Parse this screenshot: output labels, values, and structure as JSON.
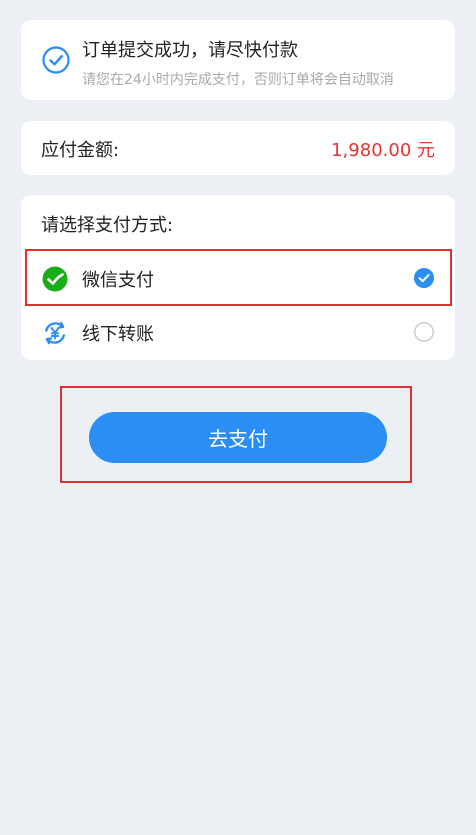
{
  "status": {
    "title": "订单提交成功，请尽快付款",
    "subtitle": "请您在24小时内完成支付，否则订单将会自动取消",
    "icon": "check-circle-icon"
  },
  "amount": {
    "label": "应付金额:",
    "value": "1,980.00 元"
  },
  "payment": {
    "header": "请选择支付方式:",
    "methods": [
      {
        "label": "微信支付",
        "icon": "wechat-icon",
        "selected": true
      },
      {
        "label": "线下转账",
        "icon": "yuan-transfer-icon",
        "selected": false
      }
    ]
  },
  "action": {
    "pay_label": "去支付"
  },
  "colors": {
    "accent": "#2a8ef5",
    "amount": "#e63232",
    "wechat": "#1aad19",
    "highlight": "#e0302d",
    "background": "#eceff3"
  }
}
